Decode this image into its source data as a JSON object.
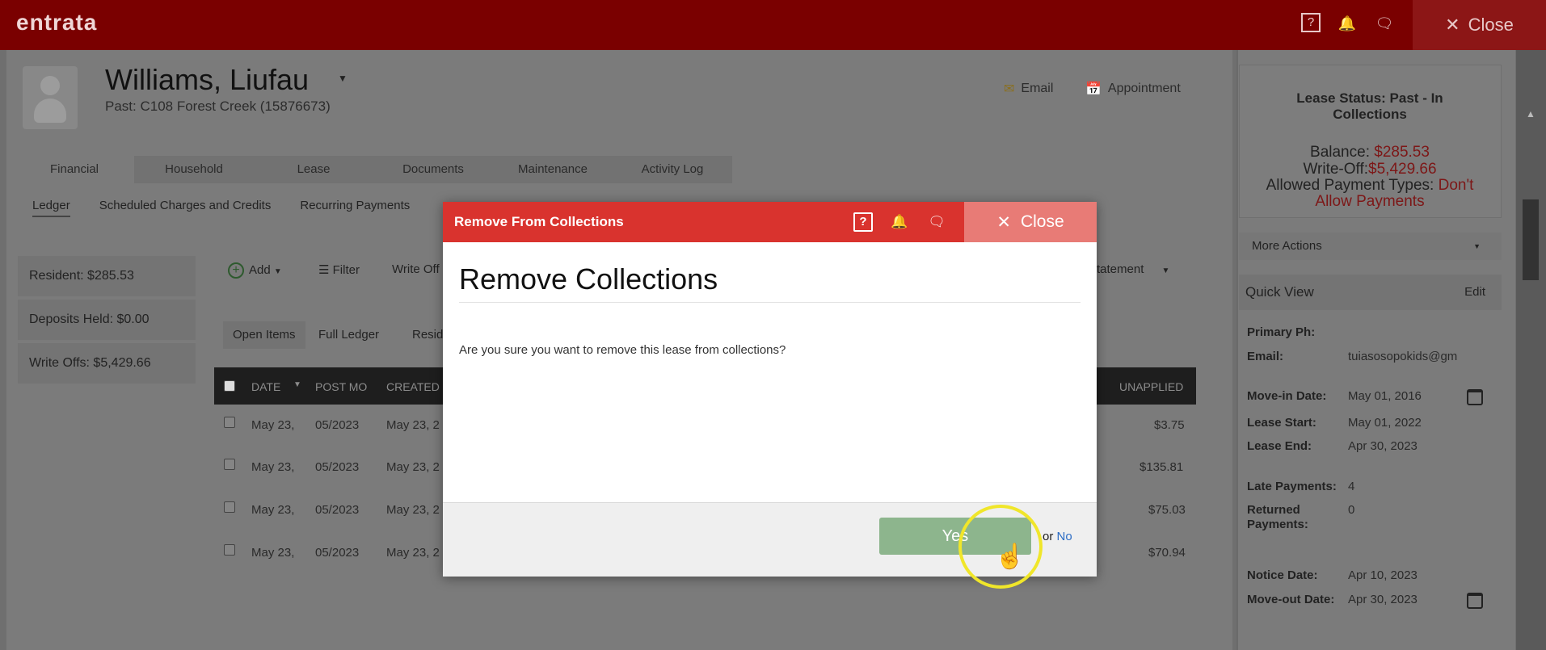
{
  "topbar": {
    "logo": "entrata",
    "close_label": "Close",
    "help_icon": "?"
  },
  "resident": {
    "name": "Williams, Liufau",
    "subtitle": "Past: C108 Forest Creek (15876673)"
  },
  "header_actions": {
    "email": "Email",
    "appointment": "Appointment"
  },
  "tabs": [
    "Financial",
    "Household",
    "Lease",
    "Documents",
    "Maintenance",
    "Activity Log"
  ],
  "subtabs": [
    "Ledger",
    "Scheduled Charges and Credits",
    "Recurring Payments"
  ],
  "left_cards": [
    "Resident: $285.53",
    "Deposits Held: $0.00",
    "Write Offs: $5,429.66"
  ],
  "toolbar": {
    "add": "Add",
    "filter": "Filter",
    "write_off": "Write Off",
    "statement": "Statement"
  },
  "view_pills": [
    "Open Items",
    "Full Ledger",
    "Resid"
  ],
  "grid": {
    "headers": {
      "date": "DATE",
      "post_month": "POST MO",
      "created": "CREATED",
      "unapplied": "UNAPPLIED"
    },
    "rows": [
      {
        "date": "May 23,",
        "post": "05/2023",
        "created": "May 23, 2",
        "unapplied": "$3.75"
      },
      {
        "date": "May 23,",
        "post": "05/2023",
        "created": "May 23, 2",
        "unapplied": "$135.81"
      },
      {
        "date": "May 23,",
        "post": "05/2023",
        "created": "May 23, 2",
        "unapplied": "$75.03"
      },
      {
        "date": "May 23,",
        "post": "05/2023",
        "created": "May 23, 2",
        "unapplied": "$70.94"
      }
    ]
  },
  "right_panel": {
    "status": "Lease Status: Past - In Collections",
    "balance_label": "Balance:",
    "balance_value": "$285.53",
    "writeoff_label": "Write-Off:",
    "writeoff_value": "$5,429.66",
    "payment_types_label": "Allowed Payment Types:",
    "payment_types_value_1": "Don't",
    "payment_types_value_2": "Allow Payments",
    "more_actions": "More Actions",
    "quick_view": "Quick View",
    "edit": "Edit",
    "fields": {
      "primary_ph_label": "Primary Ph:",
      "email_label": "Email:",
      "email_value": "tuiasosopokids@gm",
      "move_in_label": "Move-in Date:",
      "move_in_value": "May 01, 2016",
      "lease_start_label": "Lease Start:",
      "lease_start_value": "May 01, 2022",
      "lease_end_label": "Lease End:",
      "lease_end_value": "Apr 30, 2023",
      "late_payments_label": "Late Payments:",
      "late_payments_value": "4",
      "returned_label": "Returned Payments:",
      "returned_value": "0",
      "notice_label": "Notice Date:",
      "notice_value": "Apr 10, 2023",
      "move_out_label": "Move-out Date:",
      "move_out_value": "Apr 30, 2023"
    }
  },
  "modal": {
    "header_title": "Remove From Collections",
    "help_icon": "?",
    "close_label": "Close",
    "heading": "Remove Collections",
    "message": "Are you sure you want to remove this lease from collections?",
    "yes_label": "Yes",
    "or_text": "or",
    "no_label": "No"
  }
}
